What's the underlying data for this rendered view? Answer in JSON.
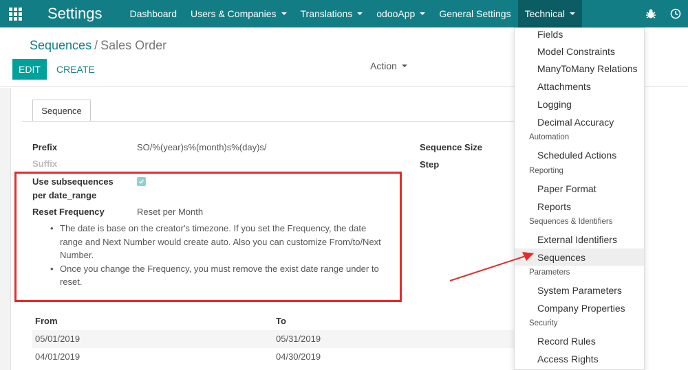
{
  "navbar": {
    "brand": "Settings",
    "menu": [
      {
        "label": "Dashboard",
        "dropdown": false
      },
      {
        "label": "Users & Companies",
        "dropdown": true
      },
      {
        "label": "Translations",
        "dropdown": true
      },
      {
        "label": "odooApp",
        "dropdown": true
      },
      {
        "label": "General Settings",
        "dropdown": false
      },
      {
        "label": "Technical",
        "dropdown": true
      }
    ],
    "systray": [
      "bug-icon",
      "clock-icon"
    ]
  },
  "breadcrumb": {
    "parent": "Sequences",
    "separator": "/",
    "current": "Sales Order"
  },
  "buttons": {
    "edit": "EDIT",
    "create": "CREATE",
    "action": "Action"
  },
  "form": {
    "tab": "Sequence",
    "prefix_label": "Prefix",
    "prefix_value": "SO/%(year)s%(month)s%(day)s/",
    "suffix_label": "Suffix",
    "sequence_size_label": "Sequence Size",
    "step_label": "Step",
    "use_subsequences_label_1": "Use subsequences",
    "use_subsequences_label_2": "per date_range",
    "use_subsequences_checked": true,
    "reset_frequency_label": "Reset Frequency",
    "reset_frequency_value": "Reset per Month",
    "notes": [
      [
        "The date is base on the creator's timezone. If you set the Frequency, the date",
        "range and Next Number would create auto. Also you can customize From/to/Next",
        "Number."
      ],
      [
        "Once you change the Frequency, you must remove the exist date range under to",
        "reset."
      ]
    ]
  },
  "table": {
    "columns": [
      "From",
      "To"
    ],
    "rows": [
      [
        "05/01/2019",
        "05/31/2019"
      ],
      [
        "04/01/2019",
        "04/30/2019"
      ]
    ]
  },
  "technical_menu": {
    "items": [
      {
        "type": "item",
        "label": "Fields"
      },
      {
        "type": "item",
        "label": "Model Constraints"
      },
      {
        "type": "item",
        "label": "ManyToMany Relations"
      },
      {
        "type": "item",
        "label": "Attachments"
      },
      {
        "type": "item",
        "label": "Logging"
      },
      {
        "type": "item",
        "label": "Decimal Accuracy"
      },
      {
        "type": "header",
        "label": "Automation"
      },
      {
        "type": "item",
        "label": "Scheduled Actions"
      },
      {
        "type": "header",
        "label": "Reporting"
      },
      {
        "type": "item",
        "label": "Paper Format"
      },
      {
        "type": "item",
        "label": "Reports"
      },
      {
        "type": "header",
        "label": "Sequences & Identifiers"
      },
      {
        "type": "item",
        "label": "External Identifiers"
      },
      {
        "type": "item",
        "label": "Sequences",
        "active": true
      },
      {
        "type": "header",
        "label": "Parameters"
      },
      {
        "type": "item",
        "label": "System Parameters"
      },
      {
        "type": "item",
        "label": "Company Properties"
      },
      {
        "type": "header",
        "label": "Security"
      },
      {
        "type": "item",
        "label": "Record Rules"
      },
      {
        "type": "item",
        "label": "Access Rights"
      }
    ]
  },
  "colors": {
    "navbar": "#127d85",
    "accent": "#00a09d",
    "annotation": "#e52b2b"
  }
}
